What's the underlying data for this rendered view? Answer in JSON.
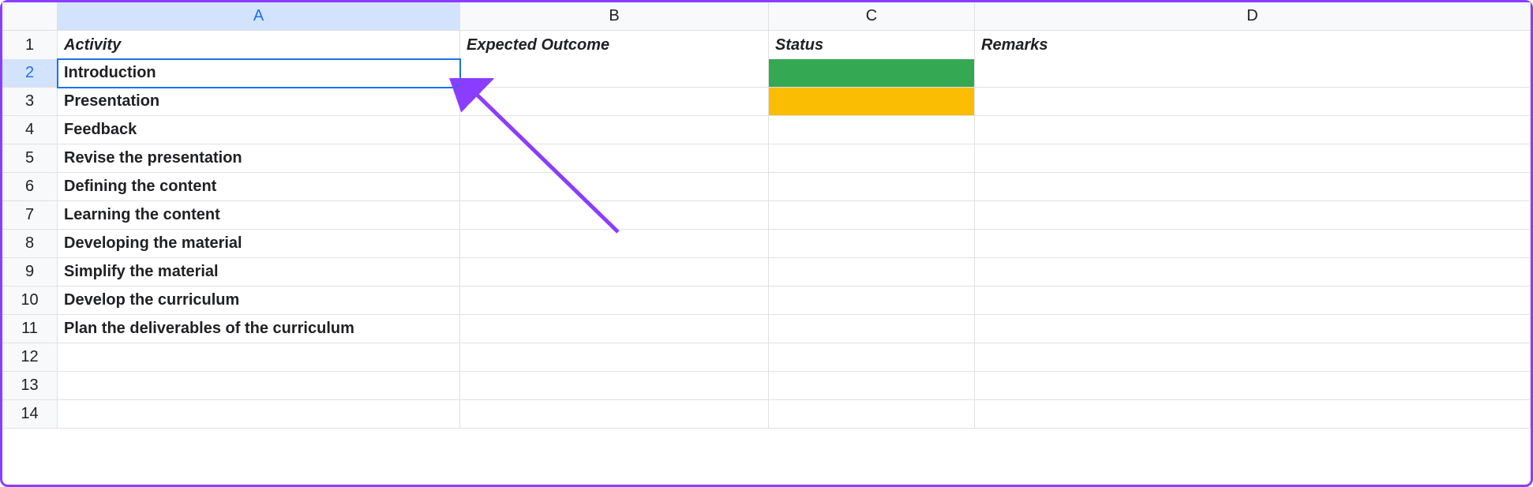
{
  "columns": [
    "A",
    "B",
    "C",
    "D"
  ],
  "selected_col_index": 0,
  "selected_row_index": 1,
  "headers": {
    "a": "Activity",
    "b": "Expected Outcome",
    "c": "Status",
    "d": "Remarks"
  },
  "rows": [
    {
      "num": "1"
    },
    {
      "num": "2",
      "a": "Introduction",
      "c_fill": "green"
    },
    {
      "num": "3",
      "a": "Presentation",
      "c_fill": "amber"
    },
    {
      "num": "4",
      "a": "Feedback"
    },
    {
      "num": "5",
      "a": "Revise the presentation"
    },
    {
      "num": "6",
      "a": "Defining the content"
    },
    {
      "num": "7",
      "a": "Learning the content"
    },
    {
      "num": "8",
      "a": "Developing the material"
    },
    {
      "num": "9",
      "a": "Simplify the material"
    },
    {
      "num": "10",
      "a": "Develop the curriculum"
    },
    {
      "num": "11",
      "a": "Plan the deliverables of the curriculum"
    },
    {
      "num": "12"
    },
    {
      "num": "13"
    },
    {
      "num": "14"
    }
  ],
  "selected_cell": "A2",
  "annotation": "purple-arrow"
}
